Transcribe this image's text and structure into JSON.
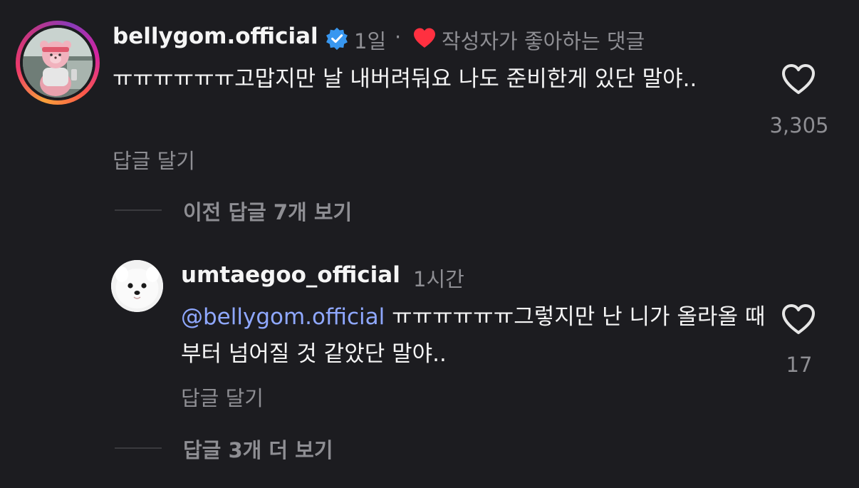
{
  "comment": {
    "username": "bellygom.official",
    "verified": true,
    "time": "1일",
    "separator": "·",
    "liked_by_author": "작성자가 좋아하는 댓글",
    "text": "ㅠㅠㅠㅠㅠㅠ고맙지만 날 내버려둬요 나도 준비한게 있단 말야..",
    "reply_label": "답글 달기",
    "like_count": "3,305",
    "view_previous": "이전 답글 7개 보기"
  },
  "reply": {
    "username": "umtaegoo_official",
    "time": "1시간",
    "mention": "@bellygom.official",
    "text": " ㅠㅠㅠㅠㅠㅠ그렇지만 난 니가 올라올 때부터 넘어질 것 같았단 말야..",
    "reply_label": "답글 달기",
    "like_count": "17",
    "view_more": "답글 3개 더 보기"
  },
  "colors": {
    "background": "#1c1c20",
    "primary_text": "#f5f5f5",
    "secondary_text": "#8e8e93",
    "mention": "#8fa8ff",
    "verified_badge": "#3897f0",
    "heart_red": "#ff3040"
  },
  "icons": {
    "verified": "verified-badge-icon",
    "author_heart": "heart-filled-icon",
    "like": "heart-outline-icon"
  }
}
